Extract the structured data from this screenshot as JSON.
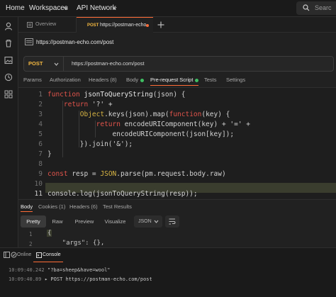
{
  "topnav": {
    "home": "Home",
    "workspaces": "Workspaces",
    "api_network": "API Network",
    "search": "Searc"
  },
  "tabs": [
    {
      "label": "Overview"
    },
    {
      "method": "POST",
      "label": "https://postman-echo.",
      "unsaved_dot": true
    }
  ],
  "request": {
    "title": "https://postman-echo.com/post",
    "method": "POST",
    "url": "https://postman-echo.com/post"
  },
  "subtabs": [
    "Params",
    "Authorization",
    "Headers (8)",
    "Body",
    "Pre-request Script",
    "Tests",
    "Settings"
  ],
  "active_subtab": "Pre-request Script",
  "editor": {
    "line_numbers": [
      "1",
      "2",
      "3",
      "4",
      "5",
      "6",
      "7",
      "8",
      "9",
      "10",
      "11"
    ],
    "active_line": 11,
    "lines": [
      [
        {
          "t": "function ",
          "c": "kw"
        },
        {
          "t": "jsonToQueryString",
          "c": "fn"
        },
        {
          "t": "(json) {",
          "c": "prop"
        }
      ],
      [
        {
          "t": "    return ",
          "c": "kw"
        },
        {
          "t": "'?'",
          "c": "str"
        },
        {
          "t": " +",
          "c": "prop"
        }
      ],
      [
        {
          "t": "        Object",
          "c": "json"
        },
        {
          "t": ".keys(json).map(",
          "c": "prop"
        },
        {
          "t": "function",
          "c": "kw"
        },
        {
          "t": "(key) {",
          "c": "prop"
        }
      ],
      [
        {
          "t": "            return ",
          "c": "kw"
        },
        {
          "t": "encodeURIComponent(key) + ",
          "c": "prop"
        },
        {
          "t": "'='",
          "c": "str"
        },
        {
          "t": " +",
          "c": "prop"
        }
      ],
      [
        {
          "t": "                encodeURIComponent(json[key]);",
          "c": "prop"
        }
      ],
      [
        {
          "t": "        }).join(",
          "c": "prop"
        },
        {
          "t": "'&'",
          "c": "str"
        },
        {
          "t": ");",
          "c": "prop"
        }
      ],
      [
        {
          "t": "}",
          "c": "prop"
        }
      ],
      [
        {
          "t": "",
          "c": "prop"
        }
      ],
      [
        {
          "t": "const ",
          "c": "kw"
        },
        {
          "t": "resp = ",
          "c": "prop"
        },
        {
          "t": "JSON",
          "c": "json"
        },
        {
          "t": ".parse(pm.request.body.raw)",
          "c": "prop"
        }
      ],
      [
        {
          "t": "",
          "c": "prop"
        }
      ],
      [
        {
          "t": "console.log(jsonToQueryString(resp));",
          "c": "prop"
        }
      ]
    ]
  },
  "response": {
    "tabs": [
      "Body",
      "Cookies (1)",
      "Headers (6)",
      "Test Results"
    ],
    "buttons": [
      "Pretty",
      "Raw",
      "Preview",
      "Visualize"
    ],
    "format": "JSON",
    "lines": [
      "1",
      "2"
    ],
    "code": [
      "{",
      "    \"args\": {},"
    ]
  },
  "console": {
    "online": "Online",
    "label": "Console",
    "entries": [
      {
        "time": "10:09:40.242",
        "text": "\"?ba=sheep&have=wool\""
      },
      {
        "time": "10:09:40.89",
        "text": "▸ POST https://postman-echo.com/post"
      }
    ]
  },
  "colors": {
    "accent": "#ff6c37",
    "green_dot": "#3fbf63",
    "method_post": "#f5b941"
  }
}
